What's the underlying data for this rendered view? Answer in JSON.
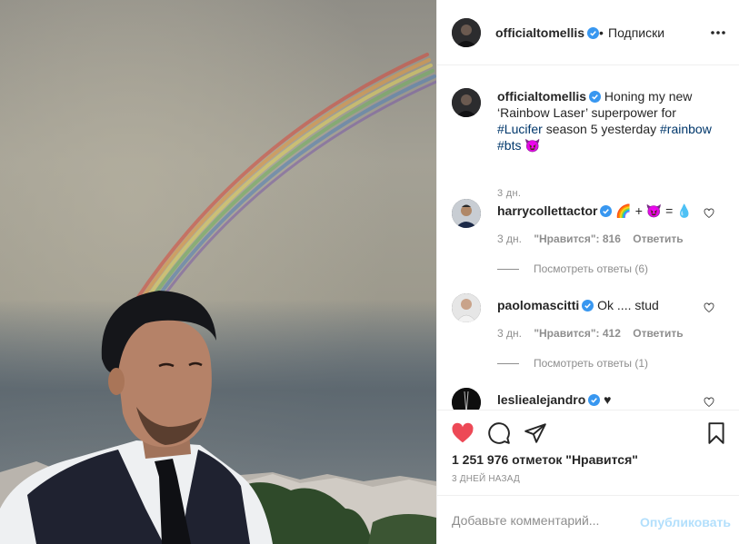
{
  "post": {
    "header": {
      "username": "officialtomellis",
      "separator": "•",
      "follow_label": "Подписки"
    },
    "caption": {
      "username": "officialtomellis",
      "text_1": "Honing my new ‘Rainbow Laser’ superpower for",
      "tag_lucifer": "#Lucifer",
      "text_2": "season 5 yesterday",
      "tag_rainbow": "#rainbow",
      "tag_bts": "#bts",
      "emoji": "😈",
      "time": "3 дн."
    },
    "comments": [
      {
        "username": "harrycollettactor",
        "text": "🌈 + 😈 = 💧",
        "time": "3 дн.",
        "likes": "\"Нравится\": 816",
        "reply_label": "Ответить",
        "replies_label": "Посмотреть ответы (6)"
      },
      {
        "username": "paolomascitti",
        "text": "Ok .... stud",
        "time": "3 дн.",
        "likes": "\"Нравится\": 412",
        "reply_label": "Ответить",
        "replies_label": "Посмотреть ответы (1)"
      },
      {
        "username": "lesliealejandro",
        "text": "♥"
      }
    ],
    "likes_count": "1 251 976 отметок \"Нравится\"",
    "posted_ago": "3 ДНЕЙ НАЗАД",
    "comment_input": {
      "placeholder": "Добавьте комментарий...",
      "value": ""
    },
    "publish_label": "Опубликовать"
  },
  "colors": {
    "like_red": "#ed4956",
    "verified_blue": "#3897f0",
    "hashtag": "#00376b",
    "muted_text": "#8e8e8e",
    "publish_disabled": "#b2dffc"
  },
  "icons": {
    "verified": "verified-badge-icon",
    "more": "more-options-icon",
    "comment_like": "heart-outline-icon",
    "like": "heart-filled-icon",
    "comment": "comment-bubble-icon",
    "share": "paper-plane-icon",
    "save": "bookmark-icon"
  }
}
